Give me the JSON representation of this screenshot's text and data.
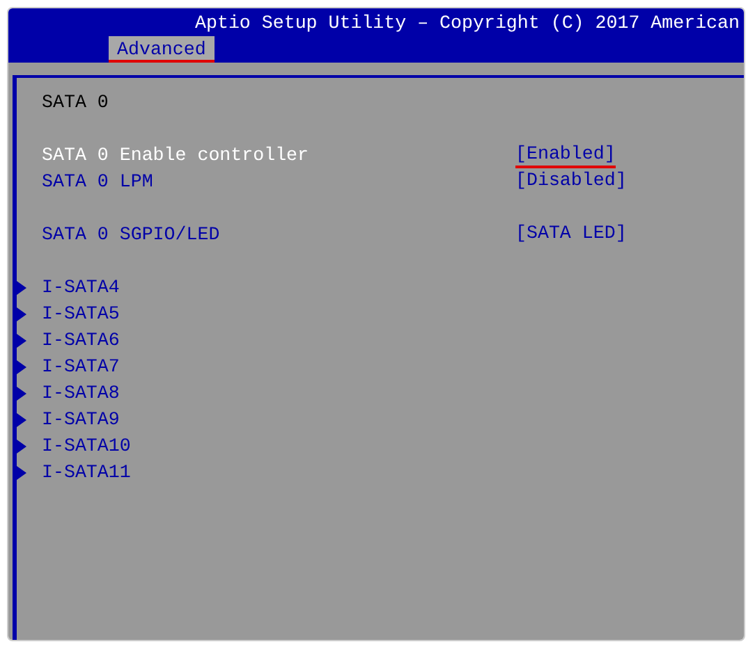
{
  "window": {
    "title": "Aptio Setup Utility – Copyright (C) 2017 American"
  },
  "tabs": [
    {
      "label": "Advanced",
      "selected": true,
      "marked": true
    }
  ],
  "section_title": "SATA 0",
  "setting_groups": [
    {
      "settings": [
        {
          "label": "SATA 0 Enable controller",
          "value": "[Enabled]",
          "selected": true,
          "marked": true
        },
        {
          "label": "SATA 0 LPM",
          "value": "[Disabled]",
          "selected": false,
          "marked": false
        }
      ]
    },
    {
      "settings": [
        {
          "label": "SATA 0 SGPIO/LED",
          "value": "[SATA LED]",
          "selected": false,
          "marked": false
        }
      ]
    }
  ],
  "submenus": [
    {
      "label": "I-SATA4"
    },
    {
      "label": "I-SATA5"
    },
    {
      "label": "I-SATA6"
    },
    {
      "label": "I-SATA7"
    },
    {
      "label": "I-SATA8"
    },
    {
      "label": "I-SATA9"
    },
    {
      "label": "I-SATA10"
    },
    {
      "label": "I-SATA11"
    }
  ]
}
